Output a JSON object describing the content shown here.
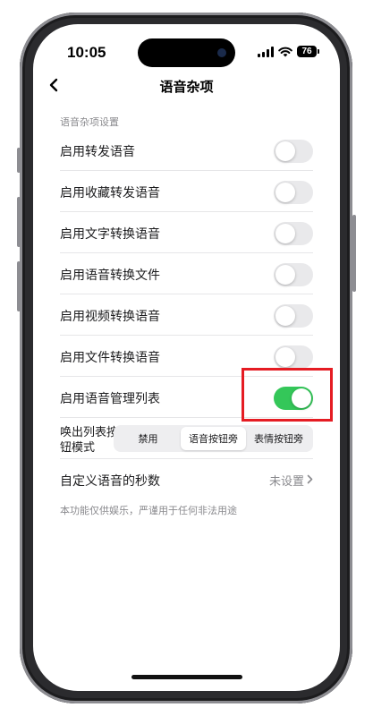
{
  "status_bar": {
    "time": "10:05",
    "battery": "76"
  },
  "nav": {
    "title": "语音杂项"
  },
  "section": {
    "header": "语音杂项设置"
  },
  "settings": [
    {
      "label": "启用转发语音",
      "enabled": false
    },
    {
      "label": "启用收藏转发语音",
      "enabled": false
    },
    {
      "label": "启用文字转换语音",
      "enabled": false
    },
    {
      "label": "启用语音转换文件",
      "enabled": false
    },
    {
      "label": "启用视频转换语音",
      "enabled": false
    },
    {
      "label": "启用文件转换语音",
      "enabled": false
    },
    {
      "label": "启用语音管理列表",
      "enabled": true
    }
  ],
  "list_mode": {
    "label": "唤出列表按钮模式",
    "options": [
      "禁用",
      "语音按钮旁",
      "表情按钮旁"
    ],
    "selected": "语音按钮旁"
  },
  "custom_seconds": {
    "label": "自定义语音的秒数",
    "value": "未设置"
  },
  "footer": "本功能仅供娱乐，严谨用于任何非法用途",
  "colors": {
    "toggle_on": "#34c759",
    "toggle_off": "#e9e9eb",
    "highlight": "#e51c23"
  }
}
